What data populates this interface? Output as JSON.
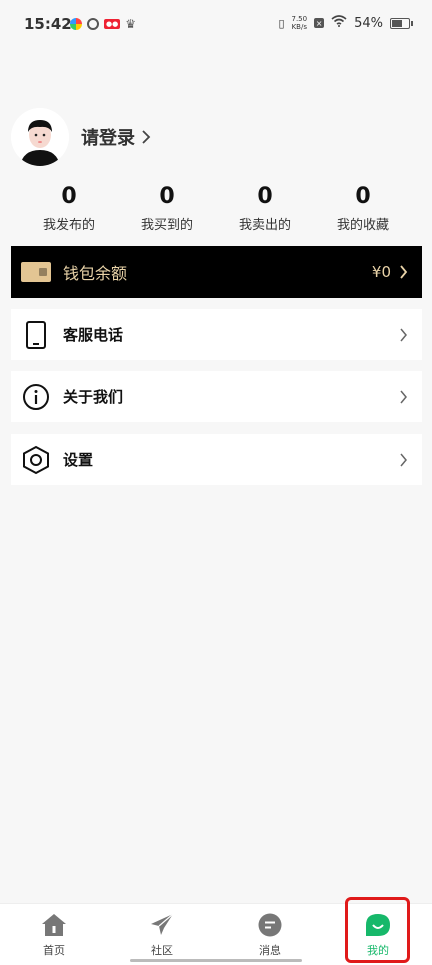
{
  "status_bar": {
    "time": "15:42",
    "net_speed_value": "7.50",
    "net_speed_unit": "KB/s",
    "battery": "54%"
  },
  "profile": {
    "login_text": "请登录"
  },
  "stats": [
    {
      "count": "0",
      "label": "我发布的"
    },
    {
      "count": "0",
      "label": "我买到的"
    },
    {
      "count": "0",
      "label": "我卖出的"
    },
    {
      "count": "0",
      "label": "我的收藏"
    }
  ],
  "wallet": {
    "label": "钱包余额",
    "balance": "¥0"
  },
  "menu": [
    {
      "label": "客服电话",
      "icon": "phone-icon"
    },
    {
      "label": "关于我们",
      "icon": "info-icon"
    },
    {
      "label": "设置",
      "icon": "hexagon-settings-icon"
    }
  ],
  "tabs": [
    {
      "label": "首页",
      "icon": "home-icon"
    },
    {
      "label": "社区",
      "icon": "paper-plane-icon"
    },
    {
      "label": "消息",
      "icon": "message-icon"
    },
    {
      "label": "我的",
      "icon": "smile-icon",
      "active": true
    }
  ],
  "colors": {
    "accent": "#16b86a",
    "wallet_bg": "#000000",
    "wallet_text": "#e9d3a8",
    "highlight": "#e01a1a"
  }
}
